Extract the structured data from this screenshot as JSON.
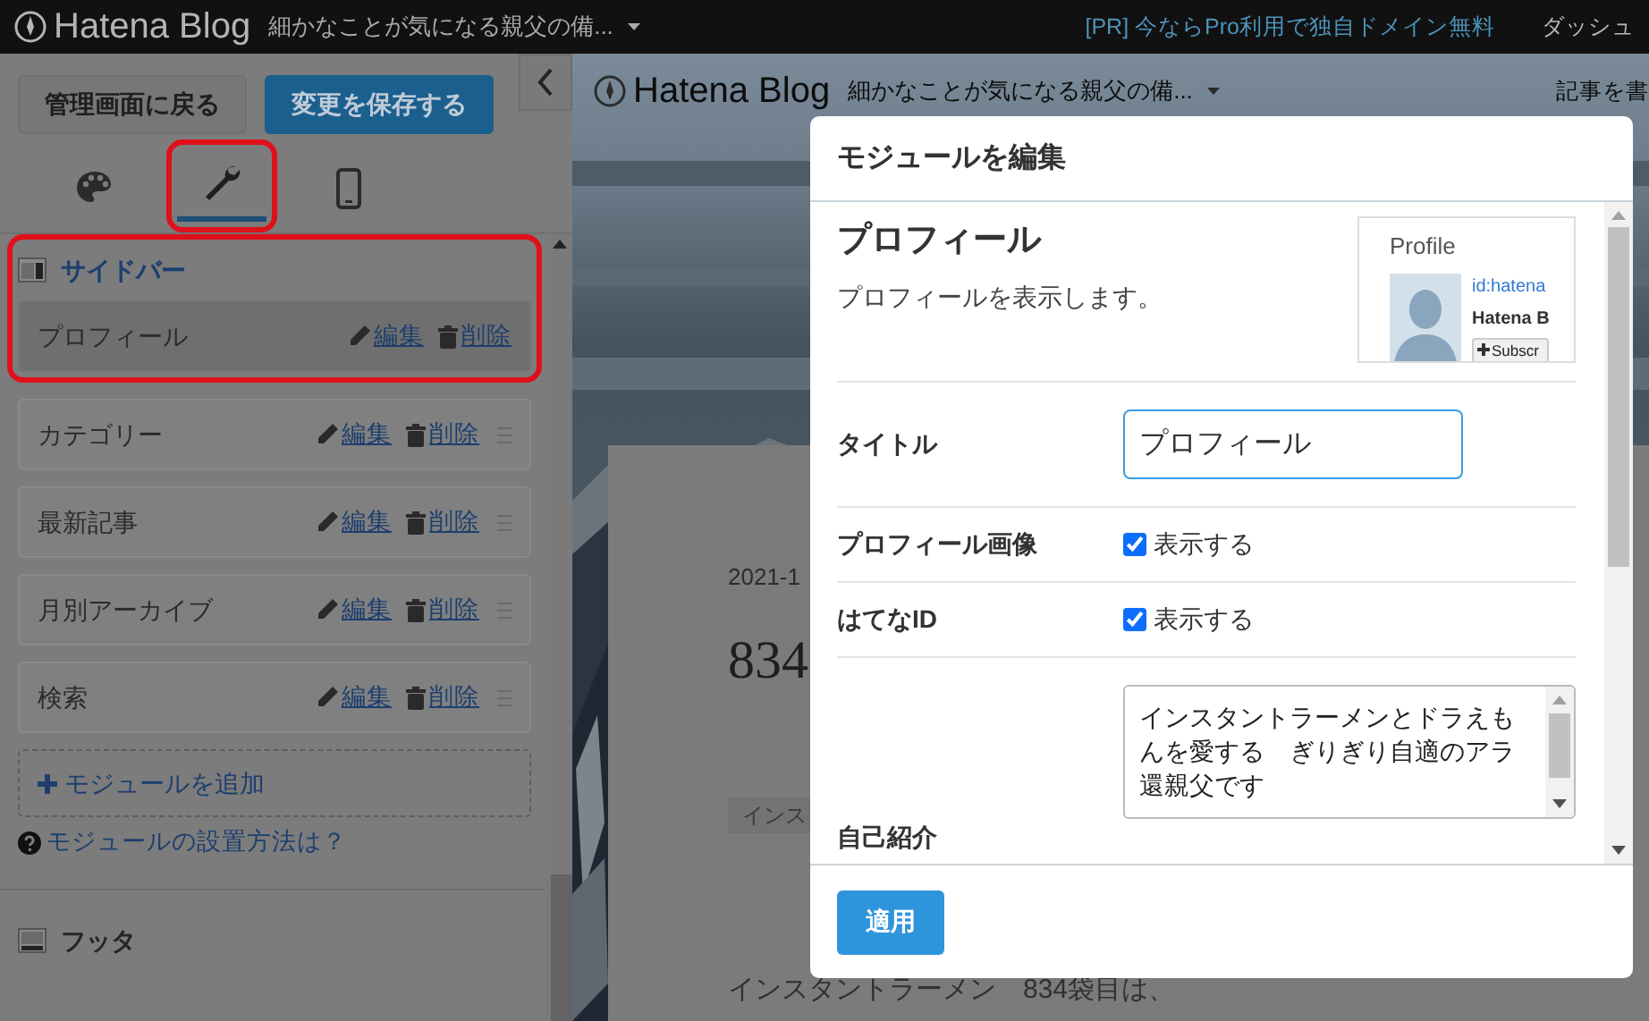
{
  "topbar": {
    "logo": "Hatena Blog",
    "blog_title": "細かなことが気になる親父の備...",
    "promo": "[PR] 今ならPro利用で独自ドメイン無料",
    "dashboard": "ダッシュ"
  },
  "editor": {
    "back_button": "管理画面に戻る",
    "save_button": "変更を保存する",
    "tabs": [
      {
        "kind": "design",
        "selected": false,
        "highlighted": false
      },
      {
        "kind": "customize",
        "selected": true,
        "highlighted": true
      },
      {
        "kind": "mobile",
        "selected": false,
        "highlighted": false
      }
    ],
    "sections": [
      {
        "kind": "sidebar",
        "title": "サイドバー",
        "highlighted": true,
        "modules": [
          {
            "name": "プロフィール",
            "selected": true,
            "edit": "編集",
            "delete": "削除"
          },
          {
            "name": "カテゴリー",
            "selected": false,
            "edit": "編集",
            "delete": "削除"
          },
          {
            "name": "最新記事",
            "selected": false,
            "edit": "編集",
            "delete": "削除"
          },
          {
            "name": "月別アーカイブ",
            "selected": false,
            "edit": "編集",
            "delete": "削除"
          },
          {
            "name": "検索",
            "selected": false,
            "edit": "編集",
            "delete": "削除"
          }
        ],
        "add_module": "モジュールを追加",
        "help_link": "モジュールの設置方法は？"
      },
      {
        "kind": "footer",
        "title": "フッタ",
        "highlighted": false
      }
    ]
  },
  "preview": {
    "logo": "Hatena Blog",
    "blog_title": "細かなことが気になる親父の備...",
    "write_link": "記事を書",
    "date": "2021-1",
    "heading": "834",
    "tag": "インス",
    "excerpt": "インスタントラーメン　834袋目は、"
  },
  "modal": {
    "title": "モジュールを編集",
    "module_title": "プロフィール",
    "description": "プロフィールを表示します。",
    "sample": {
      "heading": "Profile",
      "id": "id:hatena",
      "name": "Hatena B",
      "subscribe": "Subscr"
    },
    "fields": [
      {
        "kind": "text",
        "label": "タイトル",
        "value": "プロフィール"
      },
      {
        "kind": "checkbox",
        "label": "プロフィール画像",
        "option": "表示する",
        "checked": true
      },
      {
        "kind": "checkbox",
        "label": "はてなID",
        "option": "表示する",
        "checked": true
      },
      {
        "kind": "textarea",
        "label": "自己紹介",
        "value": "インスタントラーメンとドラえもんを愛する　ぎりぎり自適のアラ還親父です"
      }
    ],
    "apply_button": "適用"
  }
}
